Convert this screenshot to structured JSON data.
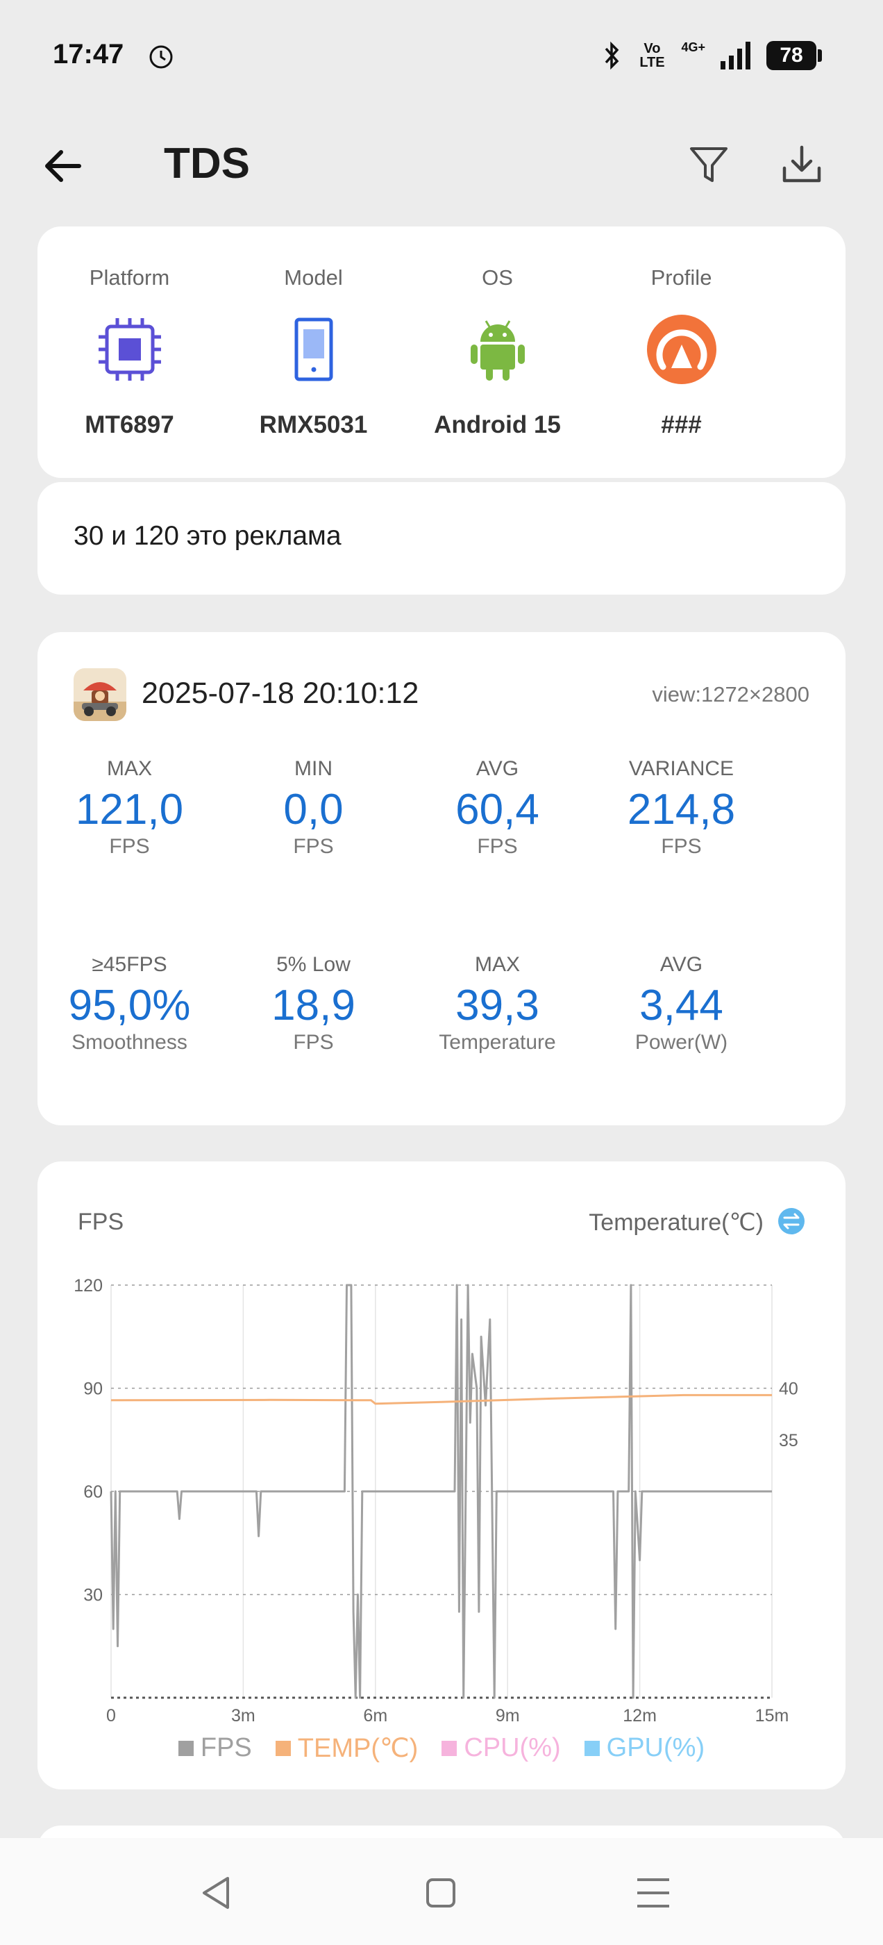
{
  "status": {
    "time": "17:47",
    "battery": "78",
    "network": "4G+",
    "volte": "Vo LTE"
  },
  "header": {
    "title": "TDS"
  },
  "device": [
    {
      "label": "Platform",
      "value": "MT6897",
      "icon": "chip-icon"
    },
    {
      "label": "Model",
      "value": "RMX5031",
      "icon": "phone-icon"
    },
    {
      "label": "OS",
      "value": "Android 15",
      "icon": "android-icon"
    },
    {
      "label": "Profile",
      "value": "###",
      "icon": "profile-gauge-icon"
    }
  ],
  "note": "30 и 120 это реклама",
  "session": {
    "date": "2025-07-18 20:10:12",
    "view": "view:1272×2800",
    "stats": [
      {
        "label": "MAX",
        "value": "121,0",
        "unit": "FPS"
      },
      {
        "label": "MIN",
        "value": "0,0",
        "unit": "FPS"
      },
      {
        "label": "AVG",
        "value": "60,4",
        "unit": "FPS"
      },
      {
        "label": "VARIANCE",
        "value": "214,8",
        "unit": "FPS"
      },
      {
        "label": "≥45FPS",
        "value": "95,0%",
        "unit": "Smoothness"
      },
      {
        "label": "5% Low",
        "value": "18,9",
        "unit": "FPS"
      },
      {
        "label": "MAX",
        "value": "39,3",
        "unit": "Temperature"
      },
      {
        "label": "AVG",
        "value": "3,44",
        "unit": "Power(W)"
      }
    ]
  },
  "chart_labels": {
    "left": "FPS",
    "right": "Temperature(℃)"
  },
  "chart_data": {
    "type": "line",
    "x_unit": "minutes",
    "x_ticks": [
      "0",
      "3m",
      "6m",
      "9m",
      "12m",
      "15m"
    ],
    "xlim": [
      0,
      15
    ],
    "y_left_ticks": [
      "120",
      "90",
      "60",
      "30"
    ],
    "ylim_left": [
      0,
      120
    ],
    "y_right_ticks": [
      "40",
      "35"
    ],
    "series": [
      {
        "name": "FPS",
        "color": "#a0a0a0",
        "points": [
          [
            0,
            60
          ],
          [
            0.05,
            20
          ],
          [
            0.1,
            60
          ],
          [
            0.15,
            15
          ],
          [
            0.2,
            60
          ],
          [
            1.5,
            60
          ],
          [
            1.55,
            52
          ],
          [
            1.6,
            60
          ],
          [
            3.3,
            60
          ],
          [
            3.35,
            47
          ],
          [
            3.4,
            60
          ],
          [
            5.3,
            60
          ],
          [
            5.35,
            120
          ],
          [
            5.45,
            120
          ],
          [
            5.5,
            25
          ],
          [
            5.55,
            0
          ],
          [
            5.6,
            30
          ],
          [
            5.65,
            0
          ],
          [
            5.7,
            60
          ],
          [
            7.8,
            60
          ],
          [
            7.85,
            120
          ],
          [
            7.9,
            25
          ],
          [
            7.95,
            110
          ],
          [
            8.0,
            0
          ],
          [
            8.05,
            60
          ],
          [
            8.1,
            120
          ],
          [
            8.15,
            80
          ],
          [
            8.2,
            100
          ],
          [
            8.3,
            90
          ],
          [
            8.35,
            25
          ],
          [
            8.4,
            105
          ],
          [
            8.5,
            85
          ],
          [
            8.6,
            110
          ],
          [
            8.7,
            0
          ],
          [
            8.75,
            60
          ],
          [
            11.4,
            60
          ],
          [
            11.45,
            20
          ],
          [
            11.5,
            60
          ],
          [
            11.75,
            60
          ],
          [
            11.8,
            120
          ],
          [
            11.85,
            0
          ],
          [
            11.9,
            60
          ],
          [
            12.0,
            40
          ],
          [
            12.05,
            60
          ],
          [
            15,
            60
          ]
        ]
      },
      {
        "name": "TEMP(℃)",
        "color": "#f5b27a",
        "points": [
          [
            0,
            86.5
          ],
          [
            3.6,
            86.6
          ],
          [
            5.9,
            86.5
          ],
          [
            6.0,
            85.5
          ],
          [
            7.5,
            86.0
          ],
          [
            10.0,
            87.0
          ],
          [
            13.0,
            88.0
          ],
          [
            15,
            88.0
          ]
        ]
      },
      {
        "name": "CPU(%)",
        "color": "#f6b3dd",
        "points": []
      },
      {
        "name": "GPU(%)",
        "color": "#87cff7",
        "points": []
      }
    ],
    "grid": true,
    "legend_position": "bottom"
  }
}
